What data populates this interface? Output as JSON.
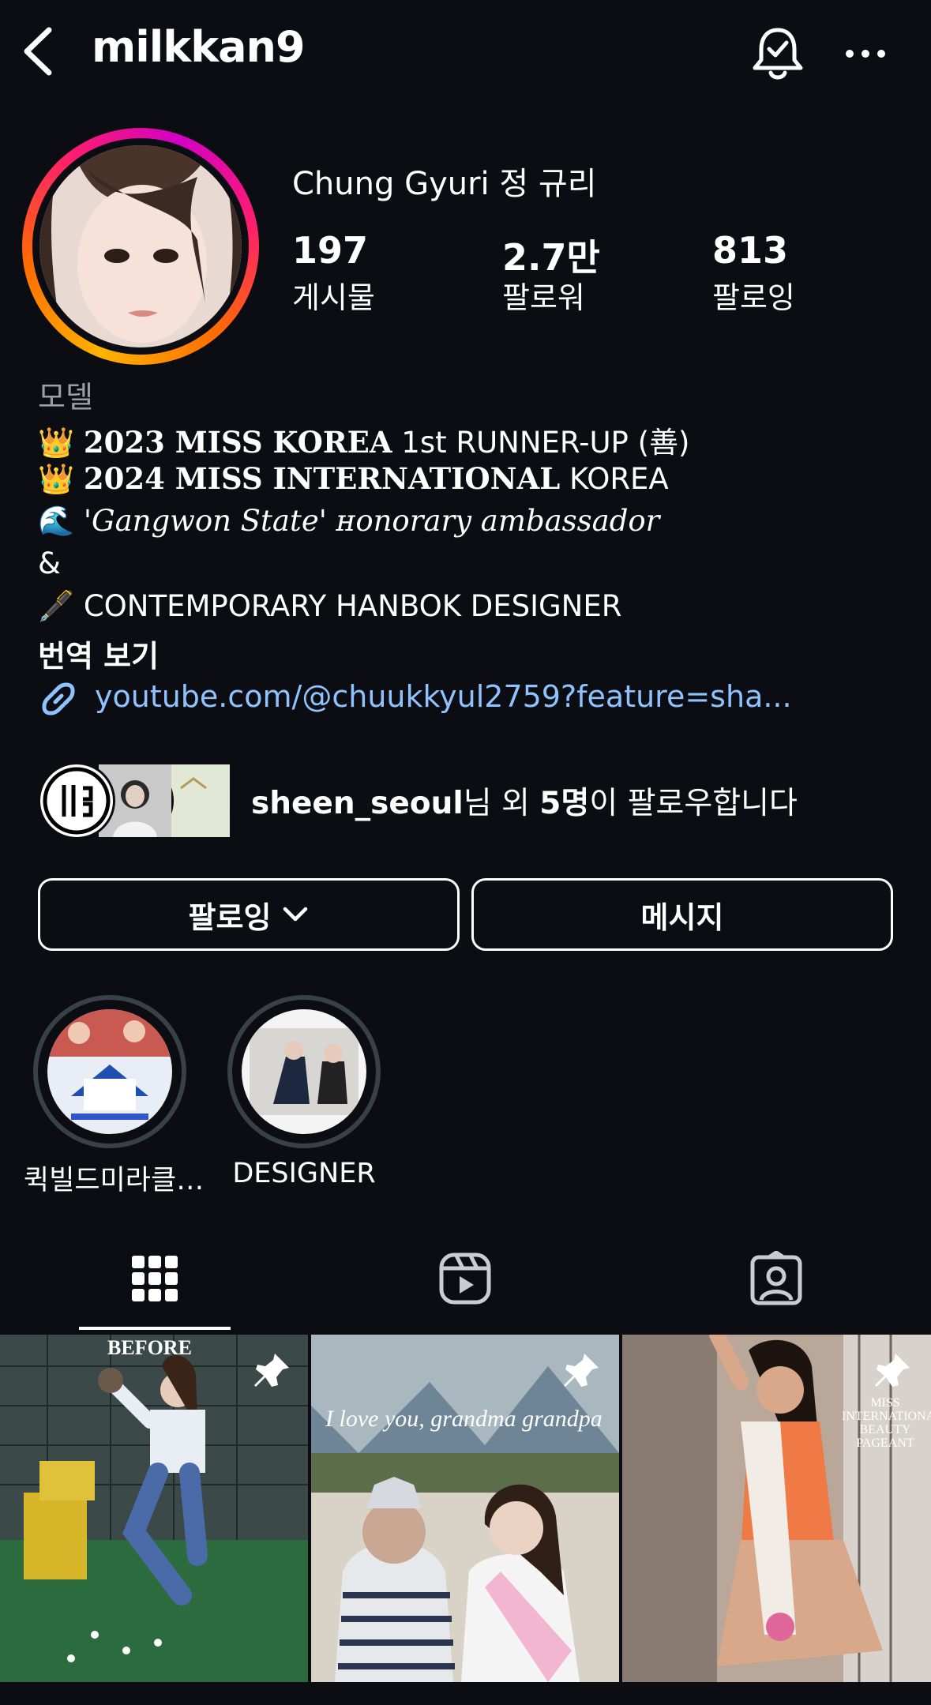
{
  "header": {
    "username": "milkkan9",
    "icons": [
      "back-arrow-icon",
      "notification-bell-icon",
      "more-icon"
    ]
  },
  "profile": {
    "display_name": "Chung Gyuri 정 규리",
    "stats": [
      {
        "value": "197",
        "label": "게시물"
      },
      {
        "value": "2.7만",
        "label": "팔로워"
      },
      {
        "value": "813",
        "label": "팔로잉"
      }
    ]
  },
  "bio": {
    "category": "모델",
    "line1_emoji": "👑",
    "line1_bold": "2023 MISS KOREA",
    "line1_rest": " 1st RUNNER-UP (善)",
    "line2_emoji": "👑",
    "line2_bold": "2024 MISS INTERNATIONAL",
    "line2_rest": " KOREA",
    "line3_emoji": "🌊",
    "line3_text": "'Gangwon State' ʜonorary ambassador",
    "line4_text": "&",
    "line5_emoji": "🖋️",
    "line5_text": " CONTEMPORARY HANBOK DESIGNER",
    "translate_label": "번역 보기",
    "link": "youtube.com/@chuukkyul2759?feature=sha..."
  },
  "followed_by": {
    "name": "sheen_seoul",
    "middle": "님 외 ",
    "count": "5명",
    "suffix": "이 팔로우합니다"
  },
  "buttons": {
    "following_label": "팔로잉",
    "message_label": "메시지"
  },
  "highlights": [
    {
      "label": "퀵빌드미라클…"
    },
    {
      "label": "DESIGNER"
    }
  ],
  "tabs": [
    "grid-icon",
    "reels-icon",
    "tagged-icon"
  ],
  "posts": [
    {
      "caption": "BEFORE",
      "pinned": true
    },
    {
      "caption": "I love you, grandma grandpa",
      "pinned": true
    },
    {
      "caption": "MISS INTERNATIONAL BEAUTY PAGEANT",
      "pinned": true
    }
  ],
  "colors": {
    "background": "#0b0d12",
    "link": "#8fc3ff",
    "muted": "#9aa0a6"
  }
}
